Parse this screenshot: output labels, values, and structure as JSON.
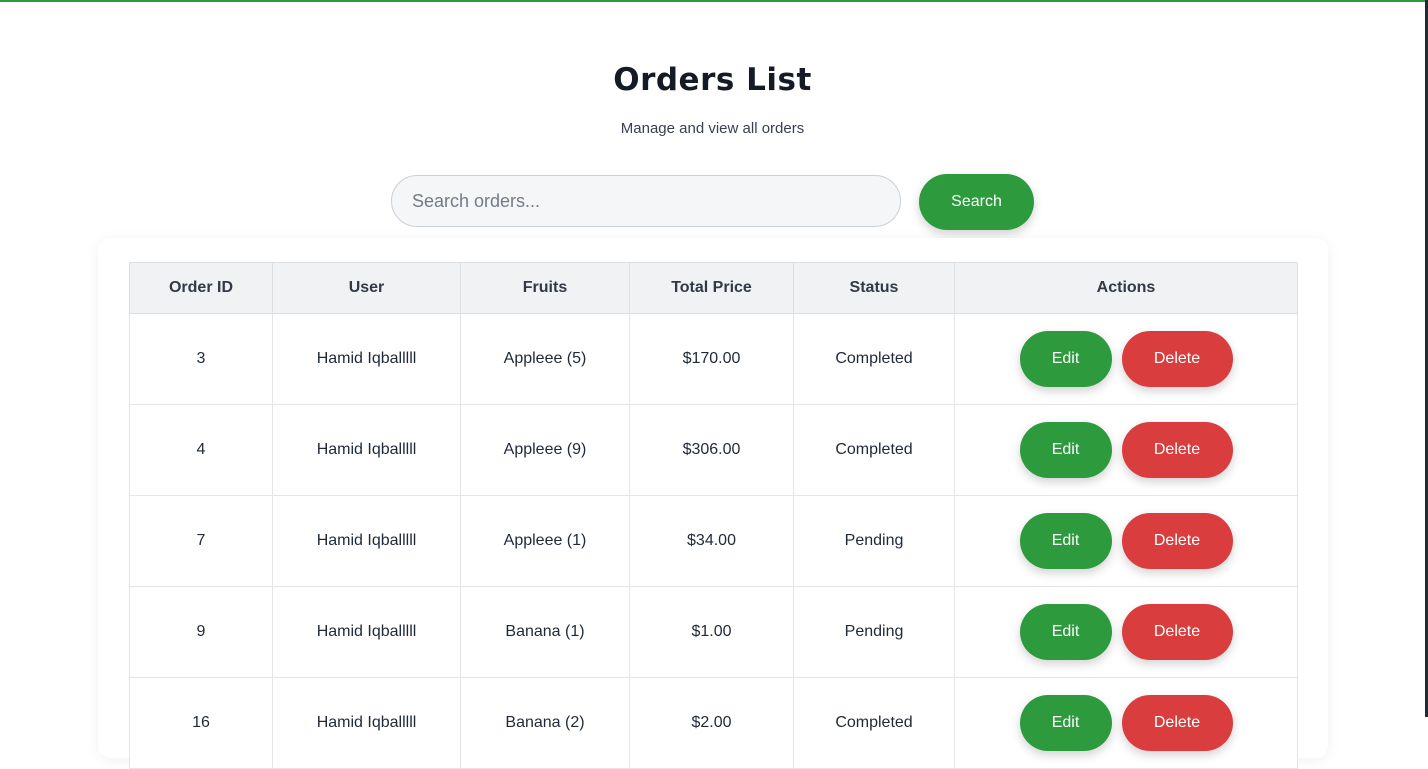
{
  "header": {
    "title": "Orders List",
    "subtitle": "Manage and view all orders"
  },
  "search": {
    "placeholder": "Search orders...",
    "value": "",
    "button_label": "Search"
  },
  "table": {
    "columns": [
      "Order ID",
      "User",
      "Fruits",
      "Total Price",
      "Status",
      "Actions"
    ],
    "rows": [
      {
        "id": "3",
        "user": "Hamid Iqballlll",
        "fruits": "Appleee (5)",
        "total": "$170.00",
        "status": "Completed",
        "edit": "Edit",
        "delete": "Delete"
      },
      {
        "id": "4",
        "user": "Hamid Iqballlll",
        "fruits": "Appleee (9)",
        "total": "$306.00",
        "status": "Completed",
        "edit": "Edit",
        "delete": "Delete"
      },
      {
        "id": "7",
        "user": "Hamid Iqballlll",
        "fruits": "Appleee (1)",
        "total": "$34.00",
        "status": "Pending",
        "edit": "Edit",
        "delete": "Delete"
      },
      {
        "id": "9",
        "user": "Hamid Iqballlll",
        "fruits": "Banana (1)",
        "total": "$1.00",
        "status": "Pending",
        "edit": "Edit",
        "delete": "Delete"
      },
      {
        "id": "16",
        "user": "Hamid Iqballlll",
        "fruits": "Banana (2)",
        "total": "$2.00",
        "status": "Completed",
        "edit": "Edit",
        "delete": "Delete"
      }
    ]
  },
  "colors": {
    "primary_green": "#2e9a3e",
    "danger_red": "#d93d3d",
    "header_bg": "#f1f2f4"
  }
}
